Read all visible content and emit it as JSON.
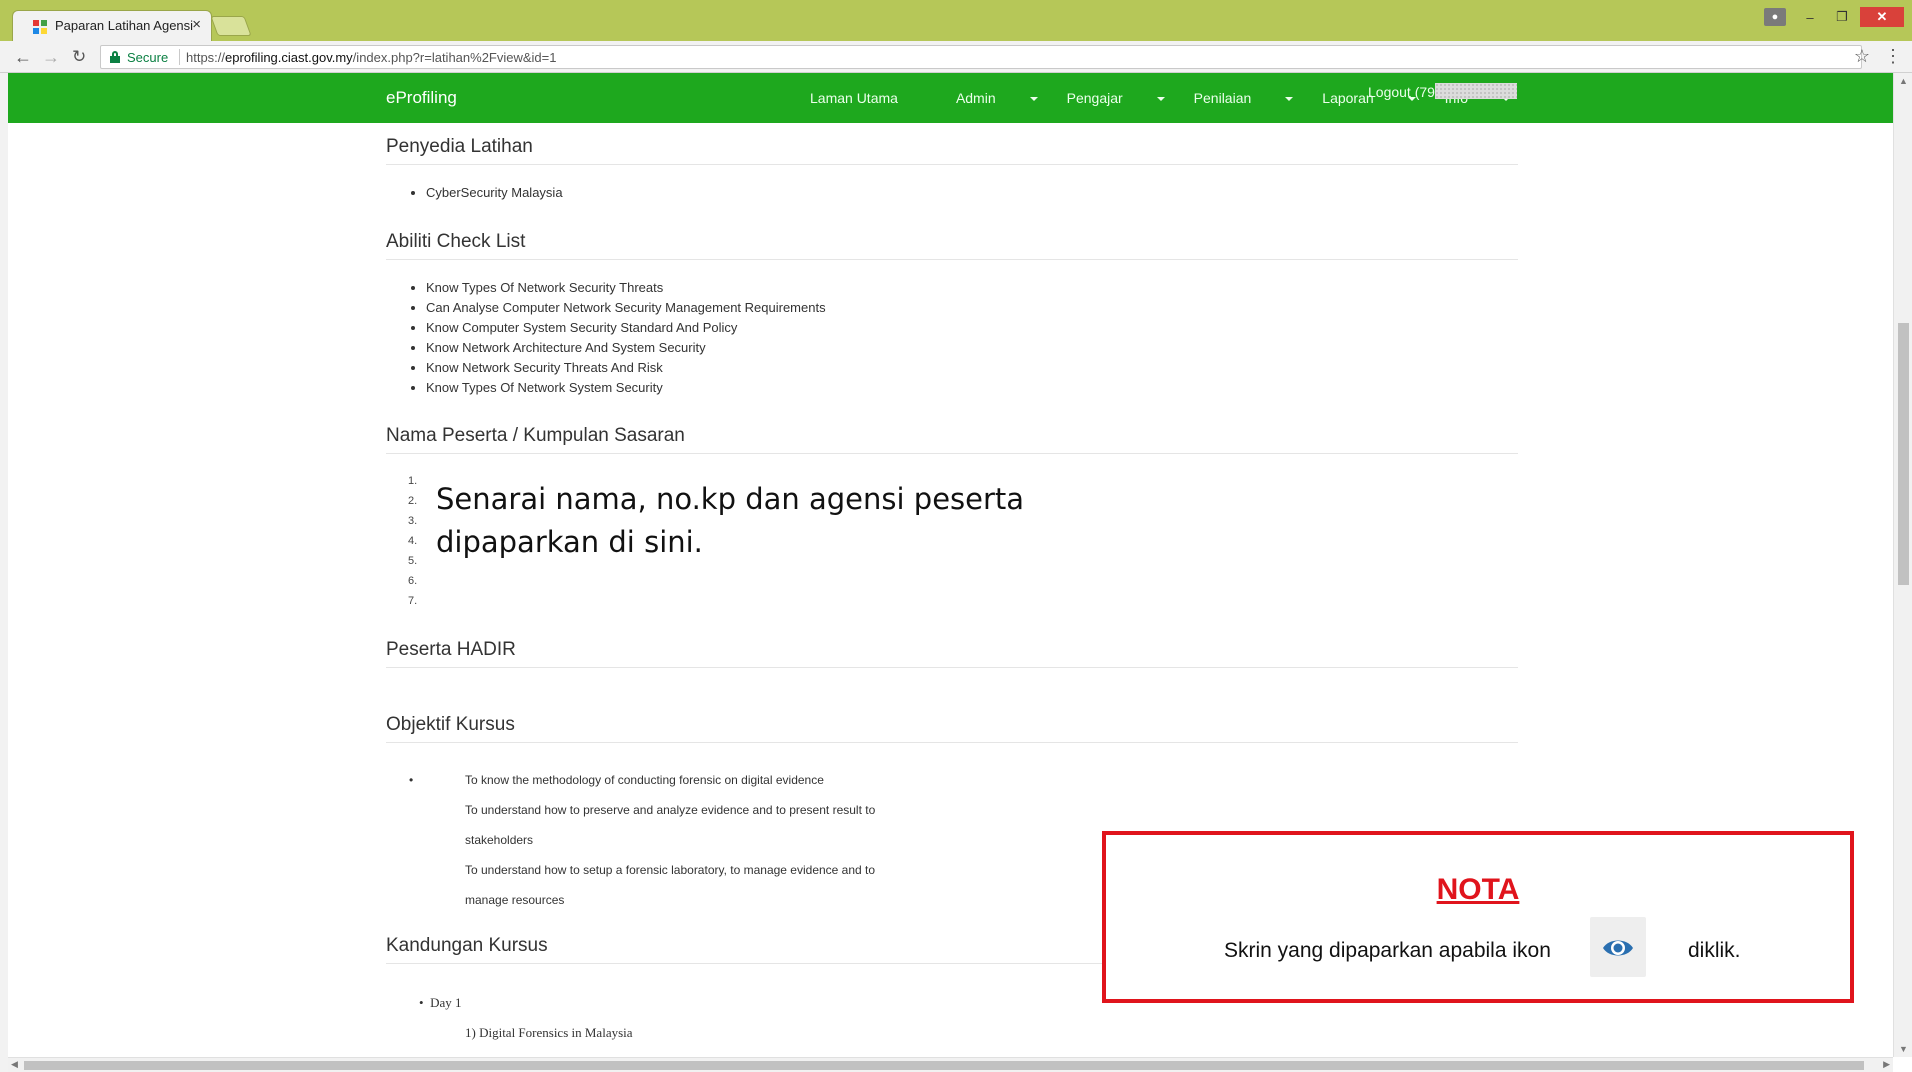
{
  "browser": {
    "tab_title": "Paparan Latihan Agensi",
    "tab_close": "×",
    "secure_label": "Secure",
    "url_prefix": "https://",
    "url_host": "eprofiling.ciast.gov.my",
    "url_path": "/index.php?r=latihan%2Fview&id=1",
    "back_icon": "back-arrow-icon",
    "forward_icon": "forward-arrow-icon",
    "reload_icon": "reload-icon"
  },
  "navbar": {
    "brand": "eProfiling",
    "links": [
      {
        "label": "Laman Utama",
        "dropdown": false
      },
      {
        "label": "Admin",
        "dropdown": true
      },
      {
        "label": "Pengajar",
        "dropdown": true
      },
      {
        "label": "Penilaian",
        "dropdown": true
      },
      {
        "label": "Laporan",
        "dropdown": true
      },
      {
        "label": "Info",
        "dropdown": true
      }
    ],
    "logout_label": "Logout (79",
    "color": "#1ea81e"
  },
  "sections": {
    "penyedia": {
      "heading": "Penyedia Latihan",
      "items": [
        "CyberSecurity Malaysia"
      ]
    },
    "abiliti": {
      "heading": "Abiliti Check List",
      "items": [
        "Know Types Of Network Security Threats",
        "Can Analyse Computer Network Security Management Requirements",
        "Know Computer System Security Standard And Policy",
        "Know Network Architecture And System Security",
        "Know Network Security Threats And Risk",
        "Know Types Of Network System Security"
      ]
    },
    "peserta": {
      "heading": "Nama Peserta / Kumpulan Sasaran",
      "numbers": [
        "1.",
        "2.",
        "3.",
        "4.",
        "5.",
        "6.",
        "7."
      ],
      "overlay_line1": "Senarai nama, no.kp dan agensi peserta",
      "overlay_line2": "dipaparkan di sini."
    },
    "hadir": {
      "heading": "Peserta HADIR"
    },
    "objektif": {
      "heading": "Objektif Kursus",
      "lines": [
        "To know the methodology of conducting forensic on digital evidence",
        "To understand how to preserve and analyze evidence and to present result to",
        "stakeholders",
        "To understand how to setup a forensic laboratory, to manage evidence and to",
        "manage resources"
      ]
    },
    "kandungan": {
      "heading": "Kandungan Kursus",
      "day": "Day 1",
      "item": "1)  Digital Forensics in Malaysia"
    }
  },
  "nota": {
    "title": "NOTA",
    "message": "Skrin yang dipaparkan apabila ikon",
    "suffix": "diklik.",
    "icon": "eye-icon",
    "border_color": "#e0141c"
  }
}
